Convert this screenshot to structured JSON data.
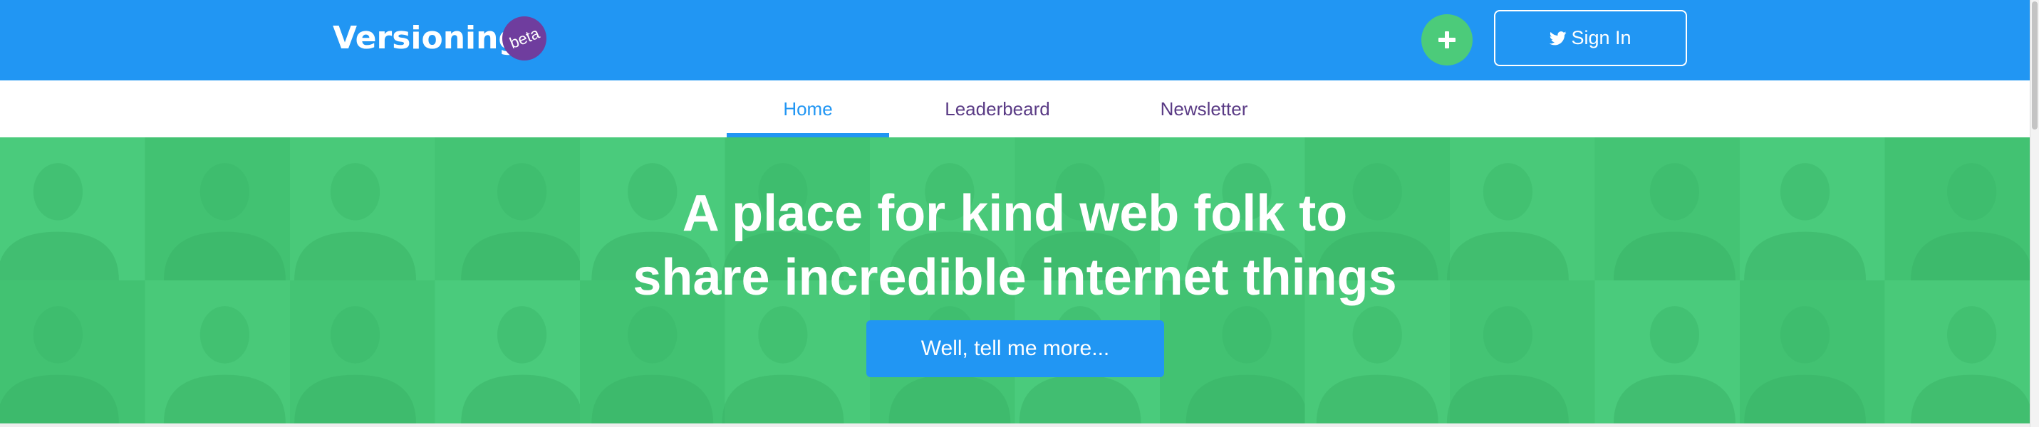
{
  "header": {
    "logo_text": "Versioning",
    "badge_text": "beta",
    "add_button_icon": "plus-icon",
    "signin_icon": "twitter-icon",
    "signin_label": "Sign In"
  },
  "nav": {
    "tabs": [
      {
        "label": "Home",
        "active": true
      },
      {
        "label": "Leaderbeard",
        "active": false
      },
      {
        "label": "Newsletter",
        "active": false
      }
    ]
  },
  "hero": {
    "title_line1": "A place for kind web folk to",
    "title_line2": "share incredible internet things",
    "cta_label": "Well, tell me more..."
  },
  "colors": {
    "header_bg": "#2196F3",
    "hero_bg": "#47C878",
    "badge_bg": "#6F3D9E",
    "add_button_bg": "#4CCB7A",
    "active_tab": "#2196F3",
    "inactive_tab": "#5A3B85"
  }
}
